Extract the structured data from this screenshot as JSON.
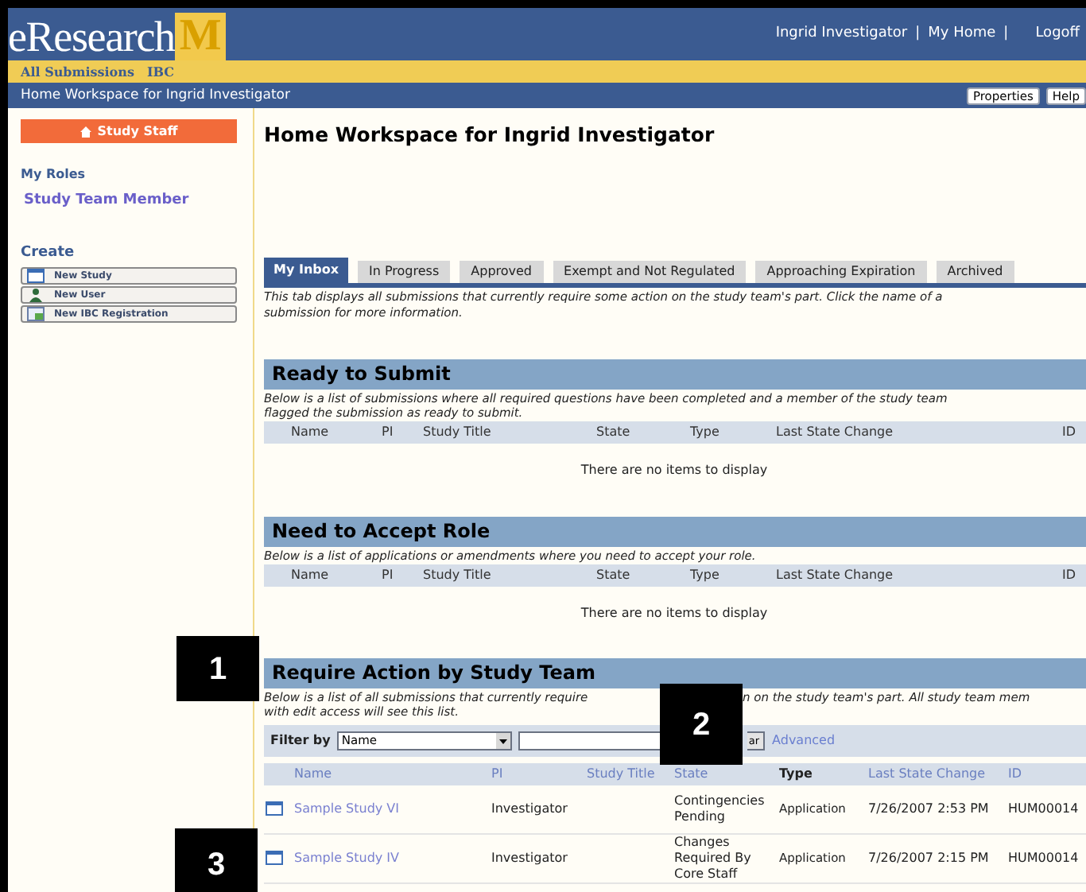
{
  "header": {
    "logo": {
      "text": "eResearch",
      "mark": "M"
    },
    "nav": [
      {
        "kind": "link",
        "text": "Ingrid Investigator"
      },
      {
        "kind": "sep",
        "text": "|"
      },
      {
        "kind": "link",
        "text": "My Home"
      },
      {
        "kind": "sep",
        "text": "|"
      },
      {
        "kind": "link",
        "text": "Logoff"
      }
    ]
  },
  "menu_bar": [
    "All Submissions",
    "IBC"
  ],
  "sub_bar": {
    "title": "Home Workspace for Ingrid Investigator",
    "buttons": [
      "Properties",
      "Help"
    ]
  },
  "sidebar": {
    "button": "Study Staff",
    "roles_heading": "My Roles",
    "roles": [
      "Study Team Member"
    ],
    "create_heading": "Create",
    "create_items": [
      {
        "label": "New Study",
        "kind": "window"
      },
      {
        "label": "New User",
        "kind": "person"
      },
      {
        "label": "New IBC Registration",
        "kind": "form"
      }
    ]
  },
  "main": {
    "title": "Home Workspace for Ingrid Investigator",
    "tabs": [
      {
        "label": "My Inbox",
        "selected": true
      },
      {
        "label": "In Progress",
        "selected": false
      },
      {
        "label": "Approved",
        "selected": false
      },
      {
        "label": "Exempt and Not Regulated",
        "selected": false
      },
      {
        "label": "Approaching Expiration",
        "selected": false
      },
      {
        "label": "Archived",
        "selected": false
      }
    ],
    "tab_description": [
      "This tab displays all submissions that currently require some action on the study team's part. Click the name of a",
      "submission for more information."
    ],
    "sections": [
      {
        "kind": "empty",
        "title": "Ready to Submit",
        "description": [
          [
            "Below is a list of submissions where all required questions have been completed and a member of the study team"
          ],
          [
            "flagged the submission as ready to submit."
          ]
        ],
        "columns": [
          "Name",
          "PI",
          "Study Title",
          "State",
          "Type",
          "Last State Change",
          "ID"
        ],
        "empty_message": "There are no items to display"
      },
      {
        "kind": "empty",
        "title": "Need to Accept Role",
        "description": [
          [
            "Below is a list of applications or amendments where you need to accept your role."
          ]
        ],
        "columns": [
          "Name",
          "PI",
          "Study Title",
          "State",
          "Type",
          "Last State Change",
          "ID"
        ],
        "empty_message": "There are no items to display"
      },
      {
        "kind": "list",
        "title": "Require Action by Study Team",
        "description": [
          [
            "Below is a list of all submissions that currently require",
            "n on the study team's part. All study team mem"
          ],
          [
            "with edit access will see this list."
          ]
        ],
        "filter": {
          "label": "Filter by",
          "select": "Name",
          "button": "ar",
          "link": "Advanced"
        },
        "columns": [
          {
            "label": "Name",
            "link": true
          },
          {
            "label": "PI",
            "link": true
          },
          {
            "label": "Study Title",
            "link": true
          },
          {
            "label": "State",
            "link": true
          },
          {
            "label": "Type",
            "link": false
          },
          {
            "label": "Last State Change",
            "link": true
          },
          {
            "label": "ID",
            "link": true
          }
        ],
        "rows": [
          [
            "Sample Study VI",
            "Investigator",
            "",
            "Contingencies Pending",
            "Application",
            "7/26/2007 2:53 PM",
            "HUM00014"
          ],
          [
            "Sample Study IV",
            "Investigator",
            "",
            "Changes Required By Core Staff",
            "Application",
            "7/26/2007 2:15 PM",
            "HUM00014"
          ]
        ]
      }
    ]
  },
  "callouts": [
    "1",
    "2",
    "3"
  ]
}
